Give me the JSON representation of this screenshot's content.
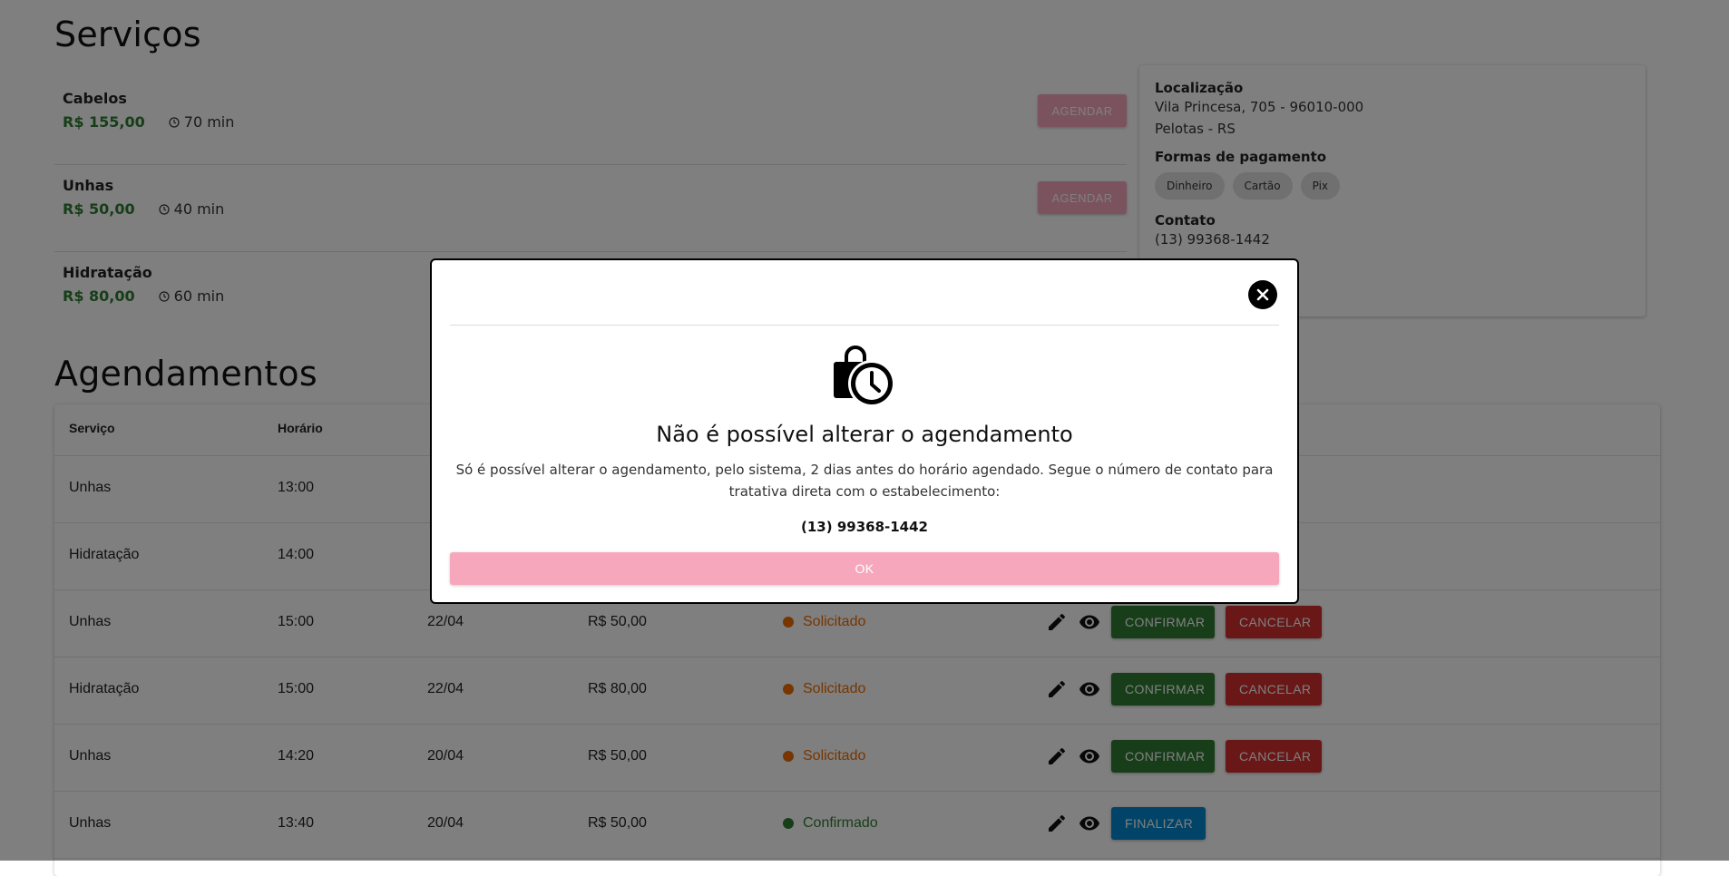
{
  "services_section": {
    "title": "Serviços",
    "book_label": "AGENDAR",
    "items": [
      {
        "name": "Cabelos",
        "price": "R$ 155,00",
        "duration": "70 min"
      },
      {
        "name": "Unhas",
        "price": "R$ 50,00",
        "duration": "40 min"
      },
      {
        "name": "Hidratação",
        "price": "R$ 80,00",
        "duration": "60 min"
      }
    ]
  },
  "info": {
    "location_label": "Localização",
    "address_line1": "Vila Princesa, 705 - 96010-000",
    "address_line2": "Pelotas - RS",
    "payment_label": "Formas de pagamento",
    "payment_methods": [
      "Dinheiro",
      "Cartão",
      "Pix"
    ],
    "contact_label": "Contato",
    "contact_phone": "(13) 99368-1442"
  },
  "appointments_section": {
    "title": "Agendamentos",
    "headers": {
      "service": "Serviço",
      "time": "Horário"
    },
    "confirm_label": "CONFIRMAR",
    "cancel_label": "CANCELAR",
    "finish_label": "FINALIZAR",
    "rows": [
      {
        "service": "Unhas",
        "time": "13:00",
        "date": "",
        "price": "",
        "status": ""
      },
      {
        "service": "Hidratação",
        "time": "14:00",
        "date": "",
        "price": "",
        "status": ""
      },
      {
        "service": "Unhas",
        "time": "15:00",
        "date": "22/04",
        "price": "R$ 50,00",
        "status": "Solicitado"
      },
      {
        "service": "Hidratação",
        "time": "15:00",
        "date": "22/04",
        "price": "R$ 80,00",
        "status": "Solicitado"
      },
      {
        "service": "Unhas",
        "time": "14:20",
        "date": "20/04",
        "price": "R$ 50,00",
        "status": "Solicitado"
      },
      {
        "service": "Unhas",
        "time": "13:40",
        "date": "20/04",
        "price": "R$ 50,00",
        "status": "Confirmado"
      }
    ]
  },
  "modal": {
    "title": "Não é possível alterar o agendamento",
    "body": "Só é possível alterar o agendamento, pelo sistema, 2 dias antes do horário agendado. Segue o número de contato para tratativa direta com o estabelecimento:",
    "phone": "(13) 99368-1442",
    "ok_label": "OK"
  },
  "colors": {
    "price": "#2e7d32",
    "status_requested": "#ef6c00",
    "status_confirmed": "#2e7d32",
    "confirm": "#2e7d32",
    "cancel": "#d32f2f",
    "finish": "#0288d1",
    "brand_pink": "#f6a7bc"
  }
}
